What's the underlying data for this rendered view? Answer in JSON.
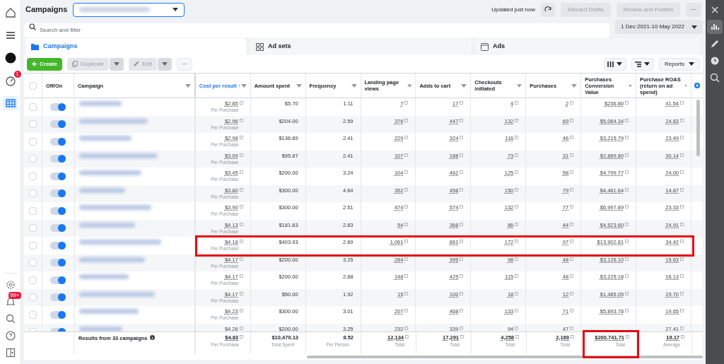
{
  "left_nav": {
    "top_items": [
      {
        "kind": "home",
        "selected": false
      },
      {
        "kind": "menu",
        "selected": false
      },
      {
        "kind": "avatar",
        "selected": false
      },
      {
        "kind": "gauge",
        "selected": false,
        "badge": "1"
      },
      {
        "kind": "table",
        "selected": true
      }
    ],
    "bottom_items": [
      {
        "kind": "settings"
      },
      {
        "kind": "bell",
        "badge": "99+"
      },
      {
        "kind": "search"
      },
      {
        "kind": "help"
      },
      {
        "kind": "panel"
      }
    ]
  },
  "header": {
    "title": "Campaigns",
    "status": "Updated just now",
    "buttons": [
      {
        "label": "Discard Drafts",
        "disabled": true
      },
      {
        "label": "Review and Publish",
        "disabled": true
      }
    ],
    "more": "···"
  },
  "search": {
    "placeholder": "Search and filter",
    "date_range": "1 Dec 2021-10 May 2022"
  },
  "tabs": [
    {
      "label": "Campaigns",
      "kind": "folder",
      "selected": true
    },
    {
      "label": "Ad sets",
      "kind": "grid",
      "selected": false
    },
    {
      "label": "Ads",
      "kind": "page",
      "selected": false
    }
  ],
  "toolbar": {
    "create": "Create",
    "duplicate": {
      "label": "Duplicate",
      "disabled": true
    },
    "edit": {
      "label": "Edit",
      "disabled": true
    },
    "more": "···",
    "reports": "Reports"
  },
  "table": {
    "all_checked": false,
    "columns": [
      {
        "label": "Off/On"
      },
      {
        "label": "Campaign"
      },
      {
        "label": "Cost per result",
        "sort": "↑",
        "sorted": true,
        "linked": true
      },
      {
        "label": "Amount spent",
        "sorted": false,
        "linked": false
      },
      {
        "label": "Frequency",
        "sorted": false,
        "linked": false
      },
      {
        "label": "Landing page views",
        "sorted": false,
        "linked": true
      },
      {
        "label": "Adds to cart",
        "sorted": false,
        "linked": true
      },
      {
        "label": "Checkouts initiated",
        "sorted": false,
        "linked": true
      },
      {
        "label": "Purchases",
        "sorted": false,
        "linked": true
      },
      {
        "label": "Purchases Conversion Value",
        "sorted": false,
        "linked": true
      },
      {
        "label": "Purchase ROAS (return on ad spend)",
        "sorted": false,
        "linked": true
      }
    ],
    "rows": [
      {
        "checked": false,
        "on": true,
        "highlighted": false,
        "note": "Per Purchase",
        "cells": {
          "cost": "$2.85",
          "spent": "$5.70",
          "freq": "1.11",
          "views": "7",
          "carts": "17",
          "checkouts": "4",
          "purchases": "2",
          "value": "$236.80",
          "roas": "41.54"
        }
      },
      {
        "checked": false,
        "on": true,
        "highlighted": false,
        "note": "Per Purchase",
        "cells": {
          "cost": "$2.96",
          "spent": "$204.00",
          "freq": "2.59",
          "views": "376",
          "carts": "447",
          "checkouts": "132",
          "purchases": "69",
          "value": "$5,064.34",
          "roas": "24.83"
        }
      },
      {
        "checked": false,
        "on": true,
        "highlighted": false,
        "note": "Per Purchase",
        "cells": {
          "cost": "$2.98",
          "spent": "$136.89",
          "freq": "2.41",
          "views": "229",
          "carts": "324",
          "checkouts": "116",
          "purchases": "46",
          "value": "$3,215.79",
          "roas": "23.49"
        }
      },
      {
        "checked": false,
        "on": true,
        "highlighted": false,
        "note": "Per Purchase",
        "cells": {
          "cost": "$3.09",
          "spent": "$95.87",
          "freq": "2.41",
          "views": "107",
          "carts": "188",
          "checkouts": "73",
          "purchases": "31",
          "value": "$2,889.80",
          "roas": "30.14"
        }
      },
      {
        "checked": false,
        "on": true,
        "highlighted": false,
        "note": "Per Purchase",
        "cells": {
          "cost": "$3.45",
          "spent": "$200.00",
          "freq": "3.24",
          "views": "104",
          "carts": "462",
          "checkouts": "125",
          "purchases": "58",
          "value": "$4,799.77",
          "roas": "24.00"
        }
      },
      {
        "checked": false,
        "on": true,
        "highlighted": false,
        "note": "Per Purchase",
        "cells": {
          "cost": "$3.80",
          "spent": "$300.00",
          "freq": "4.64",
          "views": "352",
          "carts": "458",
          "checkouts": "150",
          "purchases": "79",
          "value": "$4,461.64",
          "roas": "14.87"
        }
      },
      {
        "checked": false,
        "on": true,
        "highlighted": false,
        "note": "Per Purchase",
        "cells": {
          "cost": "$3.90",
          "spent": "$300.00",
          "freq": "2.51",
          "views": "474",
          "carts": "574",
          "checkouts": "132",
          "purchases": "77",
          "value": "$6,997.89",
          "roas": "23.33"
        }
      },
      {
        "checked": false,
        "on": true,
        "highlighted": false,
        "note": "Per Purchase",
        "cells": {
          "cost": "$4.13",
          "spent": "$181.63",
          "freq": "2.83",
          "views": "54",
          "carts": "368",
          "checkouts": "86",
          "purchases": "44",
          "value": "$4,523.60",
          "roas": "24.91"
        }
      },
      {
        "checked": false,
        "on": true,
        "highlighted": true,
        "note": "Per Purchase",
        "cells": {
          "cost": "$4.16",
          "spent": "$403.93",
          "freq": "2.69",
          "views": "1,061",
          "carts": "861",
          "checkouts": "172",
          "purchases": "97",
          "value": "$13,902.81",
          "roas": "34.42"
        }
      },
      {
        "checked": false,
        "on": true,
        "highlighted": false,
        "note": "Per Purchase",
        "cells": {
          "cost": "$4.17",
          "spent": "$200.00",
          "freq": "3.25",
          "views": "284",
          "carts": "395",
          "checkouts": "98",
          "purchases": "48",
          "value": "$3,126.10",
          "roas": "15.63"
        }
      },
      {
        "checked": false,
        "on": true,
        "highlighted": false,
        "note": "Per Purchase",
        "cells": {
          "cost": "$4.17",
          "spent": "$200.00",
          "freq": "2.68",
          "views": "148",
          "carts": "425",
          "checkouts": "115",
          "purchases": "48",
          "value": "$3,225.18",
          "roas": "16.13"
        }
      },
      {
        "checked": false,
        "on": true,
        "highlighted": false,
        "note": "Per Purchase",
        "cells": {
          "cost": "$4.17",
          "spent": "$50.00",
          "freq": "1.92",
          "views": "15",
          "carts": "100",
          "checkouts": "18",
          "purchases": "12",
          "value": "$1,485.05",
          "roas": "29.70"
        }
      },
      {
        "checked": false,
        "on": true,
        "highlighted": false,
        "note": "Per Purchase",
        "cells": {
          "cost": "$4.23",
          "spent": "$300.00",
          "freq": "3.01",
          "views": "207",
          "carts": "468",
          "checkouts": "133",
          "purchases": "71",
          "value": "$5,893.78",
          "roas": "19.65"
        }
      },
      {
        "checked": false,
        "on": true,
        "highlighted": false,
        "cells": {
          "cost": "$4.26",
          "spent": "$200.00",
          "freq": "3.25",
          "views": "232",
          "carts": "339",
          "checkouts": "94",
          "purchases": "47",
          "roas": "27.41"
        }
      }
    ],
    "footer": {
      "label": "Results from 33 campaigns",
      "cells": [
        {
          "value": "$4.83",
          "note": "Per Purchase",
          "linked": true,
          "highlighted": false
        },
        {
          "value": "$10,470.13",
          "note": "Total Spent",
          "linked": false,
          "highlighted": false
        },
        {
          "value": "8.52",
          "note": "Per Person",
          "linked": false,
          "highlighted": false
        },
        {
          "value": "12,134",
          "note": "Total",
          "linked": true,
          "highlighted": false
        },
        {
          "value": "17,291",
          "note": "Total",
          "linked": true,
          "highlighted": false
        },
        {
          "value": "4,258",
          "note": "Total",
          "linked": true,
          "highlighted": false
        },
        {
          "value": "2,169",
          "note": "Total",
          "linked": true,
          "highlighted": false
        },
        {
          "value": "$200,741.71",
          "note": "Total",
          "linked": true,
          "highlighted": true
        },
        {
          "value": "19.17",
          "note": "Average",
          "linked": true,
          "highlighted": false
        }
      ]
    }
  },
  "right_panel": {
    "items": [
      {
        "kind": "close",
        "selected": false
      },
      {
        "kind": "chart",
        "selected": true
      },
      {
        "kind": "pencil",
        "selected": false
      },
      {
        "kind": "clock",
        "selected": false
      },
      {
        "kind": "zoom",
        "selected": false
      }
    ]
  }
}
